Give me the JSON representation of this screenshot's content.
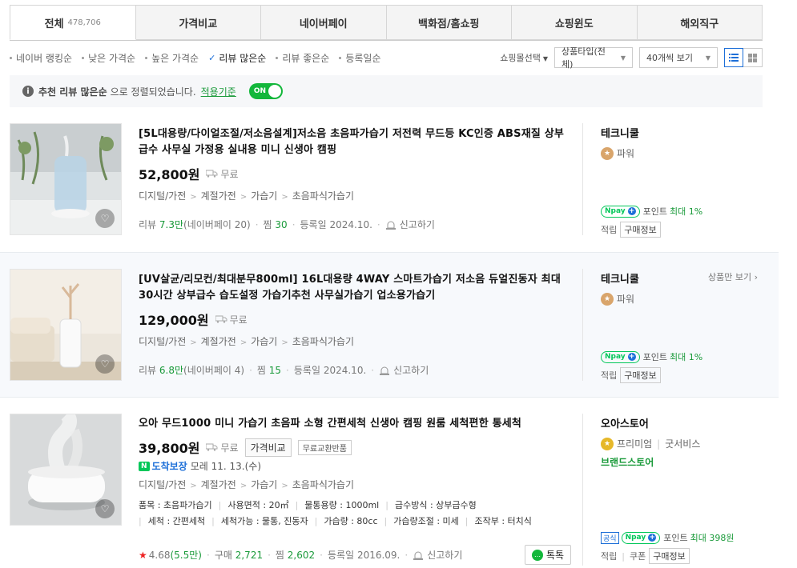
{
  "tabs": [
    {
      "label": "전체",
      "count": "478,706"
    },
    {
      "label": "가격비교",
      "count": ""
    },
    {
      "label": "네이버페이",
      "count": ""
    },
    {
      "label": "백화점/홈쇼핑",
      "count": ""
    },
    {
      "label": "쇼핑윈도",
      "count": ""
    },
    {
      "label": "해외직구",
      "count": ""
    }
  ],
  "sort": [
    {
      "label": "네이버 랭킹순"
    },
    {
      "label": "낮은 가격순"
    },
    {
      "label": "높은 가격순"
    },
    {
      "label": "리뷰 많은순"
    },
    {
      "label": "리뷰 좋은순"
    },
    {
      "label": "등록일순"
    }
  ],
  "controls": {
    "mall_select": "쇼핑몰선택",
    "product_type": "상품타입(전체)",
    "page_size": "40개씩 보기"
  },
  "notice": {
    "bold": "추천 리뷰 많은순",
    "text": "으로 정렬되었습니다.",
    "link": "적용기준",
    "toggle": "ON"
  },
  "common": {
    "free": "무료",
    "review_prefix": "리뷰",
    "zzim": "찜",
    "registered": "등록일",
    "report": "신고하기",
    "point": "포인트",
    "earn": "적립",
    "buy_info": "구매정보",
    "npay": "pay"
  },
  "items": [
    {
      "title": "[5L대용량/다이얼조절/저소음설계]저소음 초음파가습기 저전력 무드등 KC인증 ABS재질 상부급수 사무실 가정용 실내용 미니 신생아 캠핑",
      "price": "52,800원",
      "category": [
        "디지털/가전",
        "계절가전",
        "가습기",
        "초음파식가습기"
      ],
      "review_count": "7.3만",
      "review_npay": "(네이버페이 20)",
      "zzim": "30",
      "date": "2024.10.",
      "mall": "테크니쿨",
      "grade": "파워",
      "point_max": "최대 1%"
    },
    {
      "title": "[UV살균/리모컨/최대분무800ml] 16L대용량 4WAY 스마트가습기 저소음 듀얼진동자 최대30시간 상부급수 습도설정 가습기추천 사무실가습기 업소용가습기",
      "price": "129,000원",
      "category": [
        "디지털/가전",
        "계절가전",
        "가습기",
        "초음파식가습기"
      ],
      "review_count": "6.8만",
      "review_npay": "(네이버페이 4)",
      "zzim": "15",
      "date": "2024.10.",
      "mall": "테크니쿨",
      "grade": "파워",
      "point_max": "최대 1%",
      "more": "상품만 보기"
    },
    {
      "title": "오아 무드1000 미니 가습기 초음파 소형 간편세척 신생아 캠핑 원룸 세척편한 통세척",
      "price": "39,800원",
      "compare": "가격비교",
      "free_return": "무료교환반품",
      "delivery_label": "도착보장",
      "delivery_date": "모레 11. 13.(수)",
      "category": [
        "디지털/가전",
        "계절가전",
        "가습기",
        "초음파식가습기"
      ],
      "specs": [
        [
          "품목 : 초음파가습기",
          "사용면적 : 20㎡",
          "물통용량 : 1000ml",
          "급수방식 : 상부급수형"
        ],
        [
          "세척 : 간편세척",
          "세척가능 : 물통, 진동자",
          "가습량 : 80cc",
          "가습량조절 : 미세",
          "조작부 : 터치식"
        ]
      ],
      "rating": "4.68",
      "rating_count": "(5.5만)",
      "buy_label": "구매",
      "buy_count": "2,721",
      "zzim": "2,602",
      "date": "2016.09.",
      "talk": "톡톡",
      "mall": "오아스토어",
      "grade": "프리미엄",
      "grade2": "굿서비스",
      "brand_store": "브랜드스토어",
      "official": "공식",
      "point_max": "최대 398원",
      "coupon": "쿠폰"
    }
  ],
  "colors": {
    "accent": "#03c75a",
    "link_green": "#1a9a3a",
    "blue": "#1d6fd8"
  }
}
